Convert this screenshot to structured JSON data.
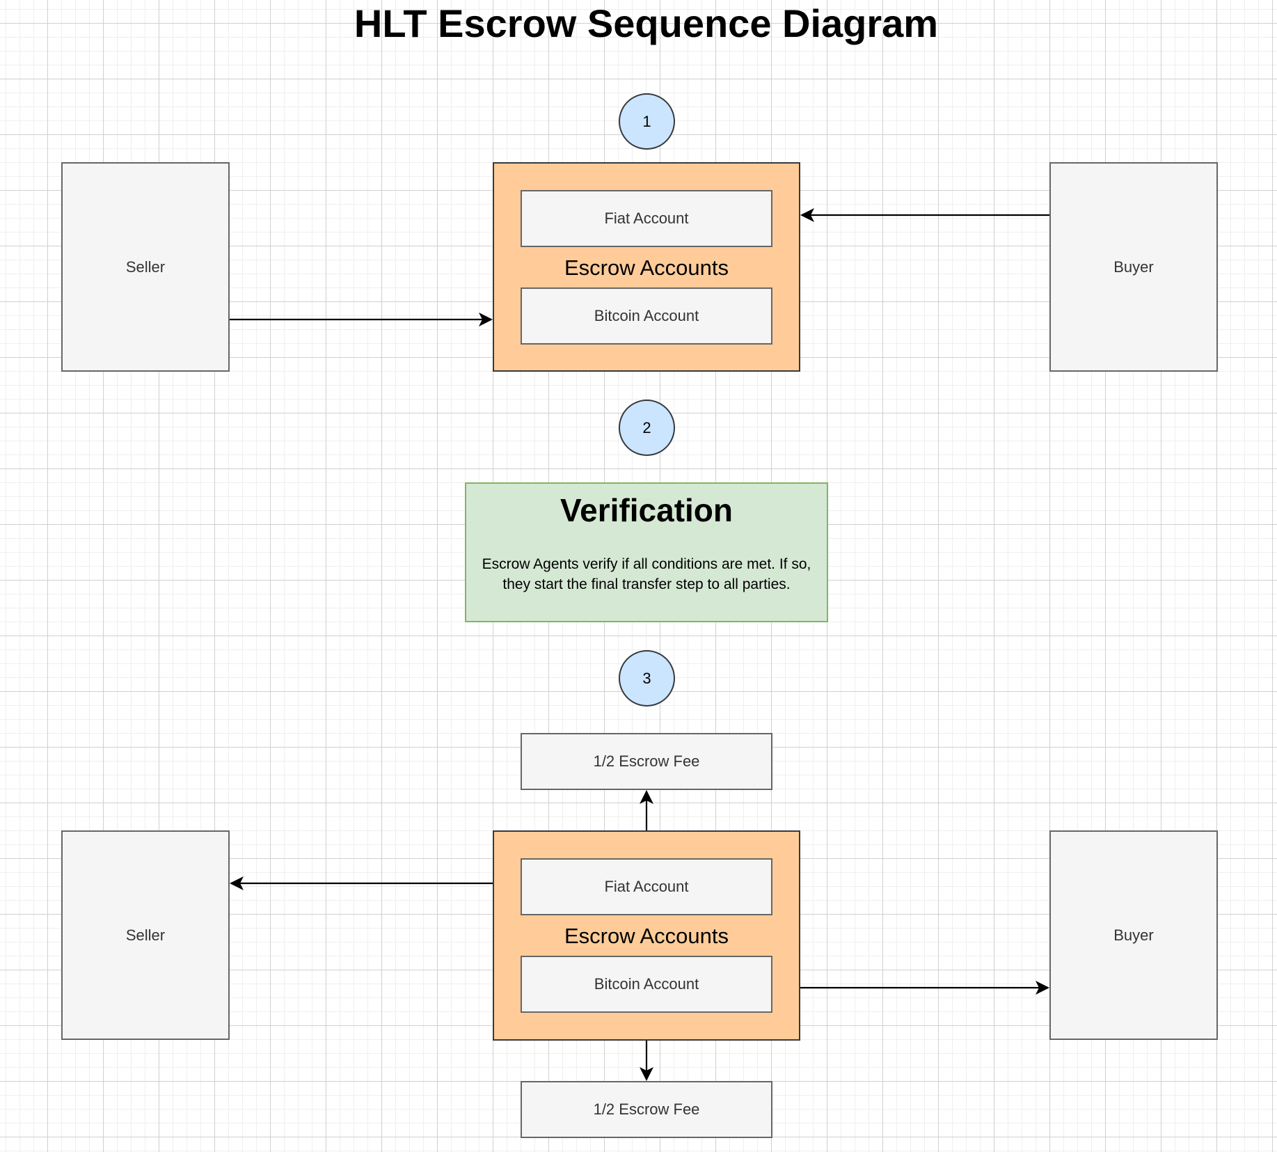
{
  "title": "HLT Escrow Sequence Diagram",
  "colors": {
    "party_fill": "#f5f5f5",
    "party_stroke": "#666666",
    "escrow_fill": "#ffcc99",
    "escrow_stroke": "#36393d",
    "step_fill": "#cce5ff",
    "verification_fill": "#d5e8d4",
    "verification_stroke": "#82b366",
    "arrow": "#000000"
  },
  "step1": {
    "number": "1",
    "seller_label": "Seller",
    "buyer_label": "Buyer",
    "escrow": {
      "label": "Escrow Accounts",
      "fiat_label": "Fiat Account",
      "bitcoin_label": "Bitcoin Account"
    },
    "flows": [
      {
        "from": "Buyer",
        "to": "Escrow Accounts (Fiat Account)"
      },
      {
        "from": "Seller",
        "to": "Escrow Accounts (Bitcoin Account)"
      }
    ]
  },
  "step2": {
    "number": "2",
    "verification": {
      "title": "Verification",
      "body": "Escrow Agents verify if all conditions are met. If so, they start the final transfer step to all parties."
    }
  },
  "step3": {
    "number": "3",
    "seller_label": "Seller",
    "buyer_label": "Buyer",
    "fee_top_label": "1/2 Escrow Fee",
    "fee_bottom_label": "1/2 Escrow Fee",
    "escrow": {
      "label": "Escrow Accounts",
      "fiat_label": "Fiat Account",
      "bitcoin_label": "Bitcoin Account"
    },
    "flows": [
      {
        "from": "Escrow Accounts (Fiat Account)",
        "to": "Seller"
      },
      {
        "from": "Escrow Accounts (Bitcoin Account)",
        "to": "Buyer"
      },
      {
        "from": "Escrow Accounts",
        "to": "1/2 Escrow Fee (top)"
      },
      {
        "from": "Escrow Accounts",
        "to": "1/2 Escrow Fee (bottom)"
      }
    ]
  }
}
